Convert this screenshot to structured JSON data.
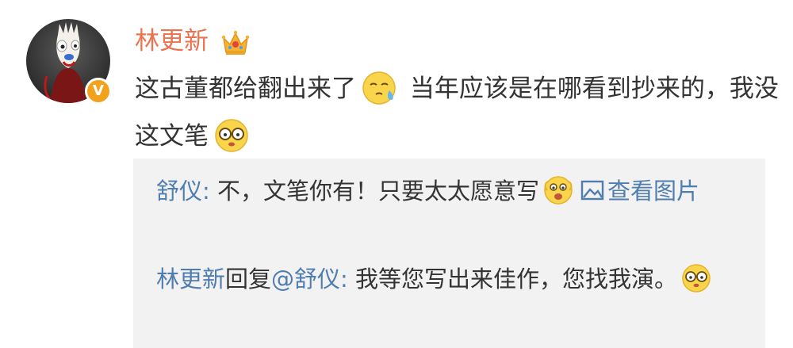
{
  "comment": {
    "username": "林更新",
    "verified_badge": "V",
    "text_part1": "这古董都给翻出来了",
    "text_part2": "当年应该是在哪看到抄来的，我没这文笔",
    "emoji1": "sweat-smile-emoji",
    "emoji2": "glasses-emoji",
    "crown_icon": "crown-icon"
  },
  "replies": [
    {
      "name": "舒仪",
      "separator": ": ",
      "text": "不，文笔你有！只要太太愿意写",
      "emoji": "excited-emoji",
      "link_label": "查看图片"
    },
    {
      "name": "林更新",
      "reply_word": "回复",
      "mention": "@舒仪",
      "separator": ": ",
      "text": "我等您写出来佳作，您找我演。",
      "emoji": "glasses-emoji"
    }
  ],
  "colors": {
    "username": "#eb7350",
    "link": "#507daf",
    "reply_bg": "#f2f2f2",
    "badge": "#f3a21d"
  }
}
